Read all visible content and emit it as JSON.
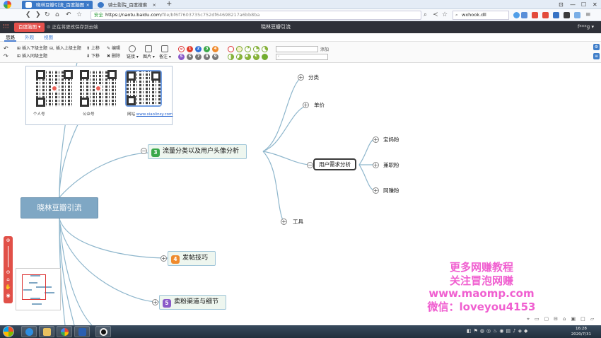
{
  "browser": {
    "tabs": [
      {
        "label": "晓林豆瓣引流_百度脑图",
        "close": "×"
      },
      {
        "label": "骑士影院_百度搜索",
        "close": "×"
      }
    ],
    "new_tab": "+",
    "window_controls": [
      "⊡",
      "—",
      "☐",
      "✕"
    ],
    "url_secure": "安全",
    "url_host": "https://naotu.baidu.com",
    "url_path": "/file/bf6f7603735c752df64698217a6bb8ba",
    "search_text": "wxhook.dll"
  },
  "app": {
    "brand": "百度脑图",
    "save_status": "正在将更改保存到云端",
    "doc_title": "晓林豆瓣引流",
    "user": "f***g"
  },
  "menu_tabs": [
    "思路",
    "外观",
    "视图"
  ],
  "toolbar": {
    "insert_child": "插入下级主题",
    "insert_parent": "插入上级主题",
    "insert_sibling": "插入同级主题",
    "move_up": "上移",
    "move_down": "下移",
    "edit": "编辑",
    "delete": "删除",
    "link": "链接",
    "image": "图片",
    "note": "备注",
    "priorities": [
      "1",
      "2",
      "3",
      "4",
      "5",
      "6",
      "7",
      "8",
      "9"
    ],
    "add": "添加"
  },
  "mindmap": {
    "root": "晓林豆瓣引流",
    "branches": [
      {
        "badge": "3",
        "label": "流量分类以及用户头像分析"
      },
      {
        "badge": "4",
        "label": "发帖技巧"
      },
      {
        "badge": "5",
        "label": "卖粉渠道与细节"
      }
    ],
    "level2": [
      "分类",
      "单价",
      "用户需求分析",
      "工具"
    ],
    "level3": [
      "宝妈粉",
      "兼职粉",
      "网赚粉"
    ],
    "qr_captions": [
      "个人号",
      "公众号",
      "网站"
    ],
    "qr_link": "www.xiaolinsy.com"
  },
  "watermark": [
    "更多网赚教程",
    "关注冒泡网赚",
    "www.maomp.com",
    "微信：loveyou4153"
  ],
  "taskbar": {
    "time": "16:28",
    "date": "2020/7/31"
  },
  "colors": {
    "accent_red": "#e4504c",
    "root_node": "#7fa7c4",
    "badge3": "#3aa84a",
    "badge4": "#ef8a2c",
    "badge5": "#8a5ac9",
    "watermark": "#f05fd0"
  }
}
